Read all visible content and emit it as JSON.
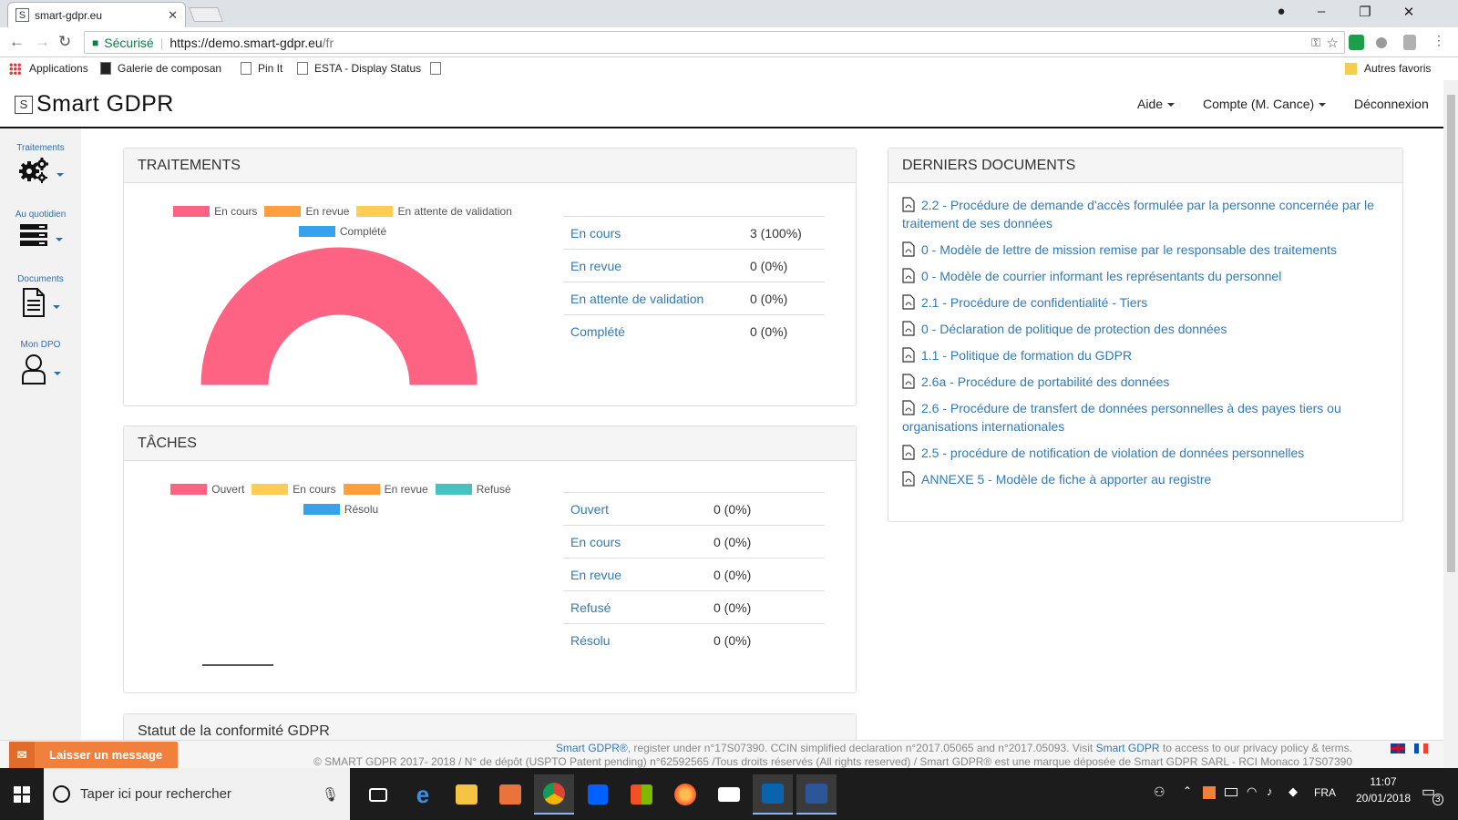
{
  "browser": {
    "tab_title": "smart-gdpr.eu",
    "tab_favicon": "S",
    "secure_label": "Sécurisé",
    "url_host": "https://demo.smart-gdpr.eu",
    "url_path": "/fr",
    "bookmarks": [
      "Applications",
      "Galerie de composan",
      "Pin It",
      "ESTA - Display Status"
    ],
    "other_bookmarks": "Autres favoris"
  },
  "header": {
    "logo_letter": "S",
    "logo_text": "Smart GDPR",
    "nav": [
      {
        "label": "Aide"
      },
      {
        "label": "Compte (M. Cance)"
      },
      {
        "label": "Déconnexion"
      }
    ]
  },
  "sidebar": {
    "items": [
      {
        "label": "Traitements",
        "icon": "gears-icon"
      },
      {
        "label": "Au quotidien",
        "icon": "server-icon"
      },
      {
        "label": "Documents",
        "icon": "document-icon"
      },
      {
        "label": "Mon DPO",
        "icon": "user-icon"
      }
    ]
  },
  "traitements": {
    "title": "TRAITEMENTS",
    "legend": [
      "En cours",
      "En revue",
      "En attente de validation",
      "Complété"
    ],
    "rows": [
      {
        "label": "En cours",
        "value": "3 (100%)"
      },
      {
        "label": "En revue",
        "value": "0 (0%)"
      },
      {
        "label": "En attente de validation",
        "value": "0 (0%)"
      },
      {
        "label": "Complété",
        "value": "0 (0%)"
      }
    ]
  },
  "taches": {
    "title": "TÂCHES",
    "legend": [
      "Ouvert",
      "En cours",
      "En revue",
      "Refusé",
      "Résolu"
    ],
    "rows": [
      {
        "label": "Ouvert",
        "value": "0 (0%)"
      },
      {
        "label": "En cours",
        "value": "0 (0%)"
      },
      {
        "label": "En revue",
        "value": "0 (0%)"
      },
      {
        "label": "Refusé",
        "value": "0 (0%)"
      },
      {
        "label": "Résolu",
        "value": "0 (0%)"
      }
    ]
  },
  "statut": {
    "title": "Statut de la conformité GDPR"
  },
  "documents": {
    "title": "DERNIERS DOCUMENTS",
    "items": [
      "2.2 - Procédure de demande d'accès formulée par la personne concernée par le traitement de ses données",
      "0 - Modèle de lettre de mission remise par le responsable des traitements",
      "0 - Modèle de courrier informant les représentants du personnel",
      "2.1 - Procédure de confidentialité - Tiers",
      "0 - Déclaration de politique de protection des données",
      "1.1 - Politique de formation du GDPR",
      "2.6a - Procédure de portabilité des données",
      "2.6 - Procédure de transfert de données personnelles à des payes tiers ou organisations internationales",
      "2.5 - procédure de notification de violation de données personnelles",
      "ANNEXE 5 - Modèle de fiche à apporter au registre"
    ]
  },
  "footer": {
    "brand": "Smart GDPR®",
    "line1_mid": ", register under n°17S07390. CCIN simplified declaration n°2017.05065 and n°2017.05093. Visit ",
    "line1_link": "Smart GDPR",
    "line1_end": " to access to our privacy policy & terms.",
    "line2": "© SMART GDPR 2017- 2018 / N° de dépôt (USPTO Patent pending) n°62592565 /Tous droits réservés (All rights reserved) / Smart GDPR® est une marque déposée de Smart GDPR SARL - RCI Monaco 17S07390"
  },
  "chat": {
    "label": "Laisser un message"
  },
  "taskbar": {
    "search_placeholder": "Taper ici pour rechercher",
    "lang": "FRA",
    "time": "11:07",
    "date": "20/01/2018",
    "notif_count": "3"
  },
  "colors": {
    "en_cours": "#ff6384",
    "en_revue": "#ff9f40",
    "en_attente": "#ffcd56",
    "complete": "#36a2eb",
    "refuse": "#4bc0c0",
    "link": "#337ab7"
  },
  "chart_data": [
    {
      "type": "pie",
      "variant": "half-doughnut",
      "categories": [
        "En cours",
        "En revue",
        "En attente de validation",
        "Complété"
      ],
      "values": [
        3,
        0,
        0,
        0
      ]
    },
    {
      "type": "pie",
      "variant": "half-doughnut",
      "categories": [
        "Ouvert",
        "En cours",
        "En revue",
        "Refusé",
        "Résolu"
      ],
      "values": [
        0,
        0,
        0,
        0,
        0
      ]
    }
  ]
}
